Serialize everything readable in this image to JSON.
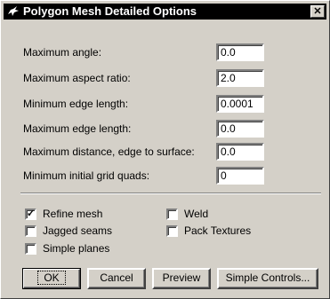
{
  "window": {
    "title": "Polygon Mesh Detailed Options",
    "close_glyph": "✕",
    "icon": "rhino-icon"
  },
  "fields": [
    {
      "label": "Maximum angle:",
      "value": "0.0"
    },
    {
      "label": "Maximum aspect ratio:",
      "value": "2.0"
    },
    {
      "label": "Minimum edge length:",
      "value": "0.0001"
    },
    {
      "label": "Maximum edge length:",
      "value": "0.0"
    },
    {
      "label": "Maximum distance, edge to surface:",
      "value": "0.0"
    },
    {
      "label": "Minimum initial grid quads:",
      "value": "0"
    }
  ],
  "checkboxes": [
    {
      "label": "Refine mesh",
      "checked": true,
      "mark": "✓"
    },
    {
      "label": "Jagged seams",
      "checked": false,
      "mark": ""
    },
    {
      "label": "Simple planes",
      "checked": false,
      "mark": ""
    },
    {
      "label": "Weld",
      "checked": false,
      "mark": ""
    },
    {
      "label": "Pack Textures",
      "checked": false,
      "mark": ""
    }
  ],
  "buttons": {
    "ok": "OK",
    "cancel": "Cancel",
    "preview": "Preview",
    "simple_controls": "Simple Controls..."
  },
  "colors": {
    "dialog_face": "#d4d0c8",
    "titlebar": "#000000",
    "field_bg": "#ffffff"
  }
}
